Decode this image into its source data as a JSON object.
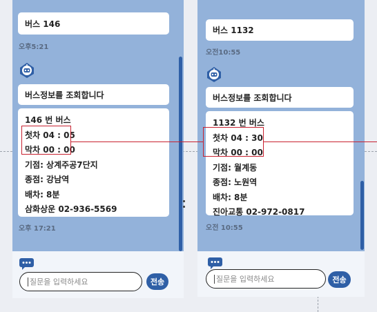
{
  "left": {
    "top_message": "버스 146",
    "top_timestamp": "오후5:21",
    "query_message": "버스정보를 조회합니다",
    "info": {
      "bus_title": "146 번 버스",
      "first": "첫차 04 : 05",
      "last": "막차 00 : 00",
      "origin": "기점: 상계주공7단지",
      "terminus": "종점: 강남역",
      "interval": "배차: 8분",
      "company": "삼화상운 02-936-5569"
    },
    "info_timestamp": "오후 17:21",
    "input_placeholder": "질문을 입력하세요",
    "send_label": "전송"
  },
  "right": {
    "top_message": "버스 1132",
    "top_timestamp": "오전10:55",
    "query_message": "버스정보를 조회합니다",
    "info": {
      "bus_title": "1132 번 버스",
      "first": "첫차 04 : 30",
      "last": "막차 00 : 00",
      "origin": "기점: 월계동",
      "terminus": "종점: 노원역",
      "interval": "배차: 8분",
      "company": "진아교통 02-972-0817"
    },
    "info_timestamp": "오전 10:55",
    "input_placeholder": "질문을 입력하세요",
    "send_label": "전송"
  },
  "colors": {
    "chat_background": "#93b2da",
    "accent": "#2f5fa6",
    "highlight": "#c8202f"
  },
  "icons": [
    "chatbot-avatar-icon",
    "chat-bubble-icon"
  ]
}
